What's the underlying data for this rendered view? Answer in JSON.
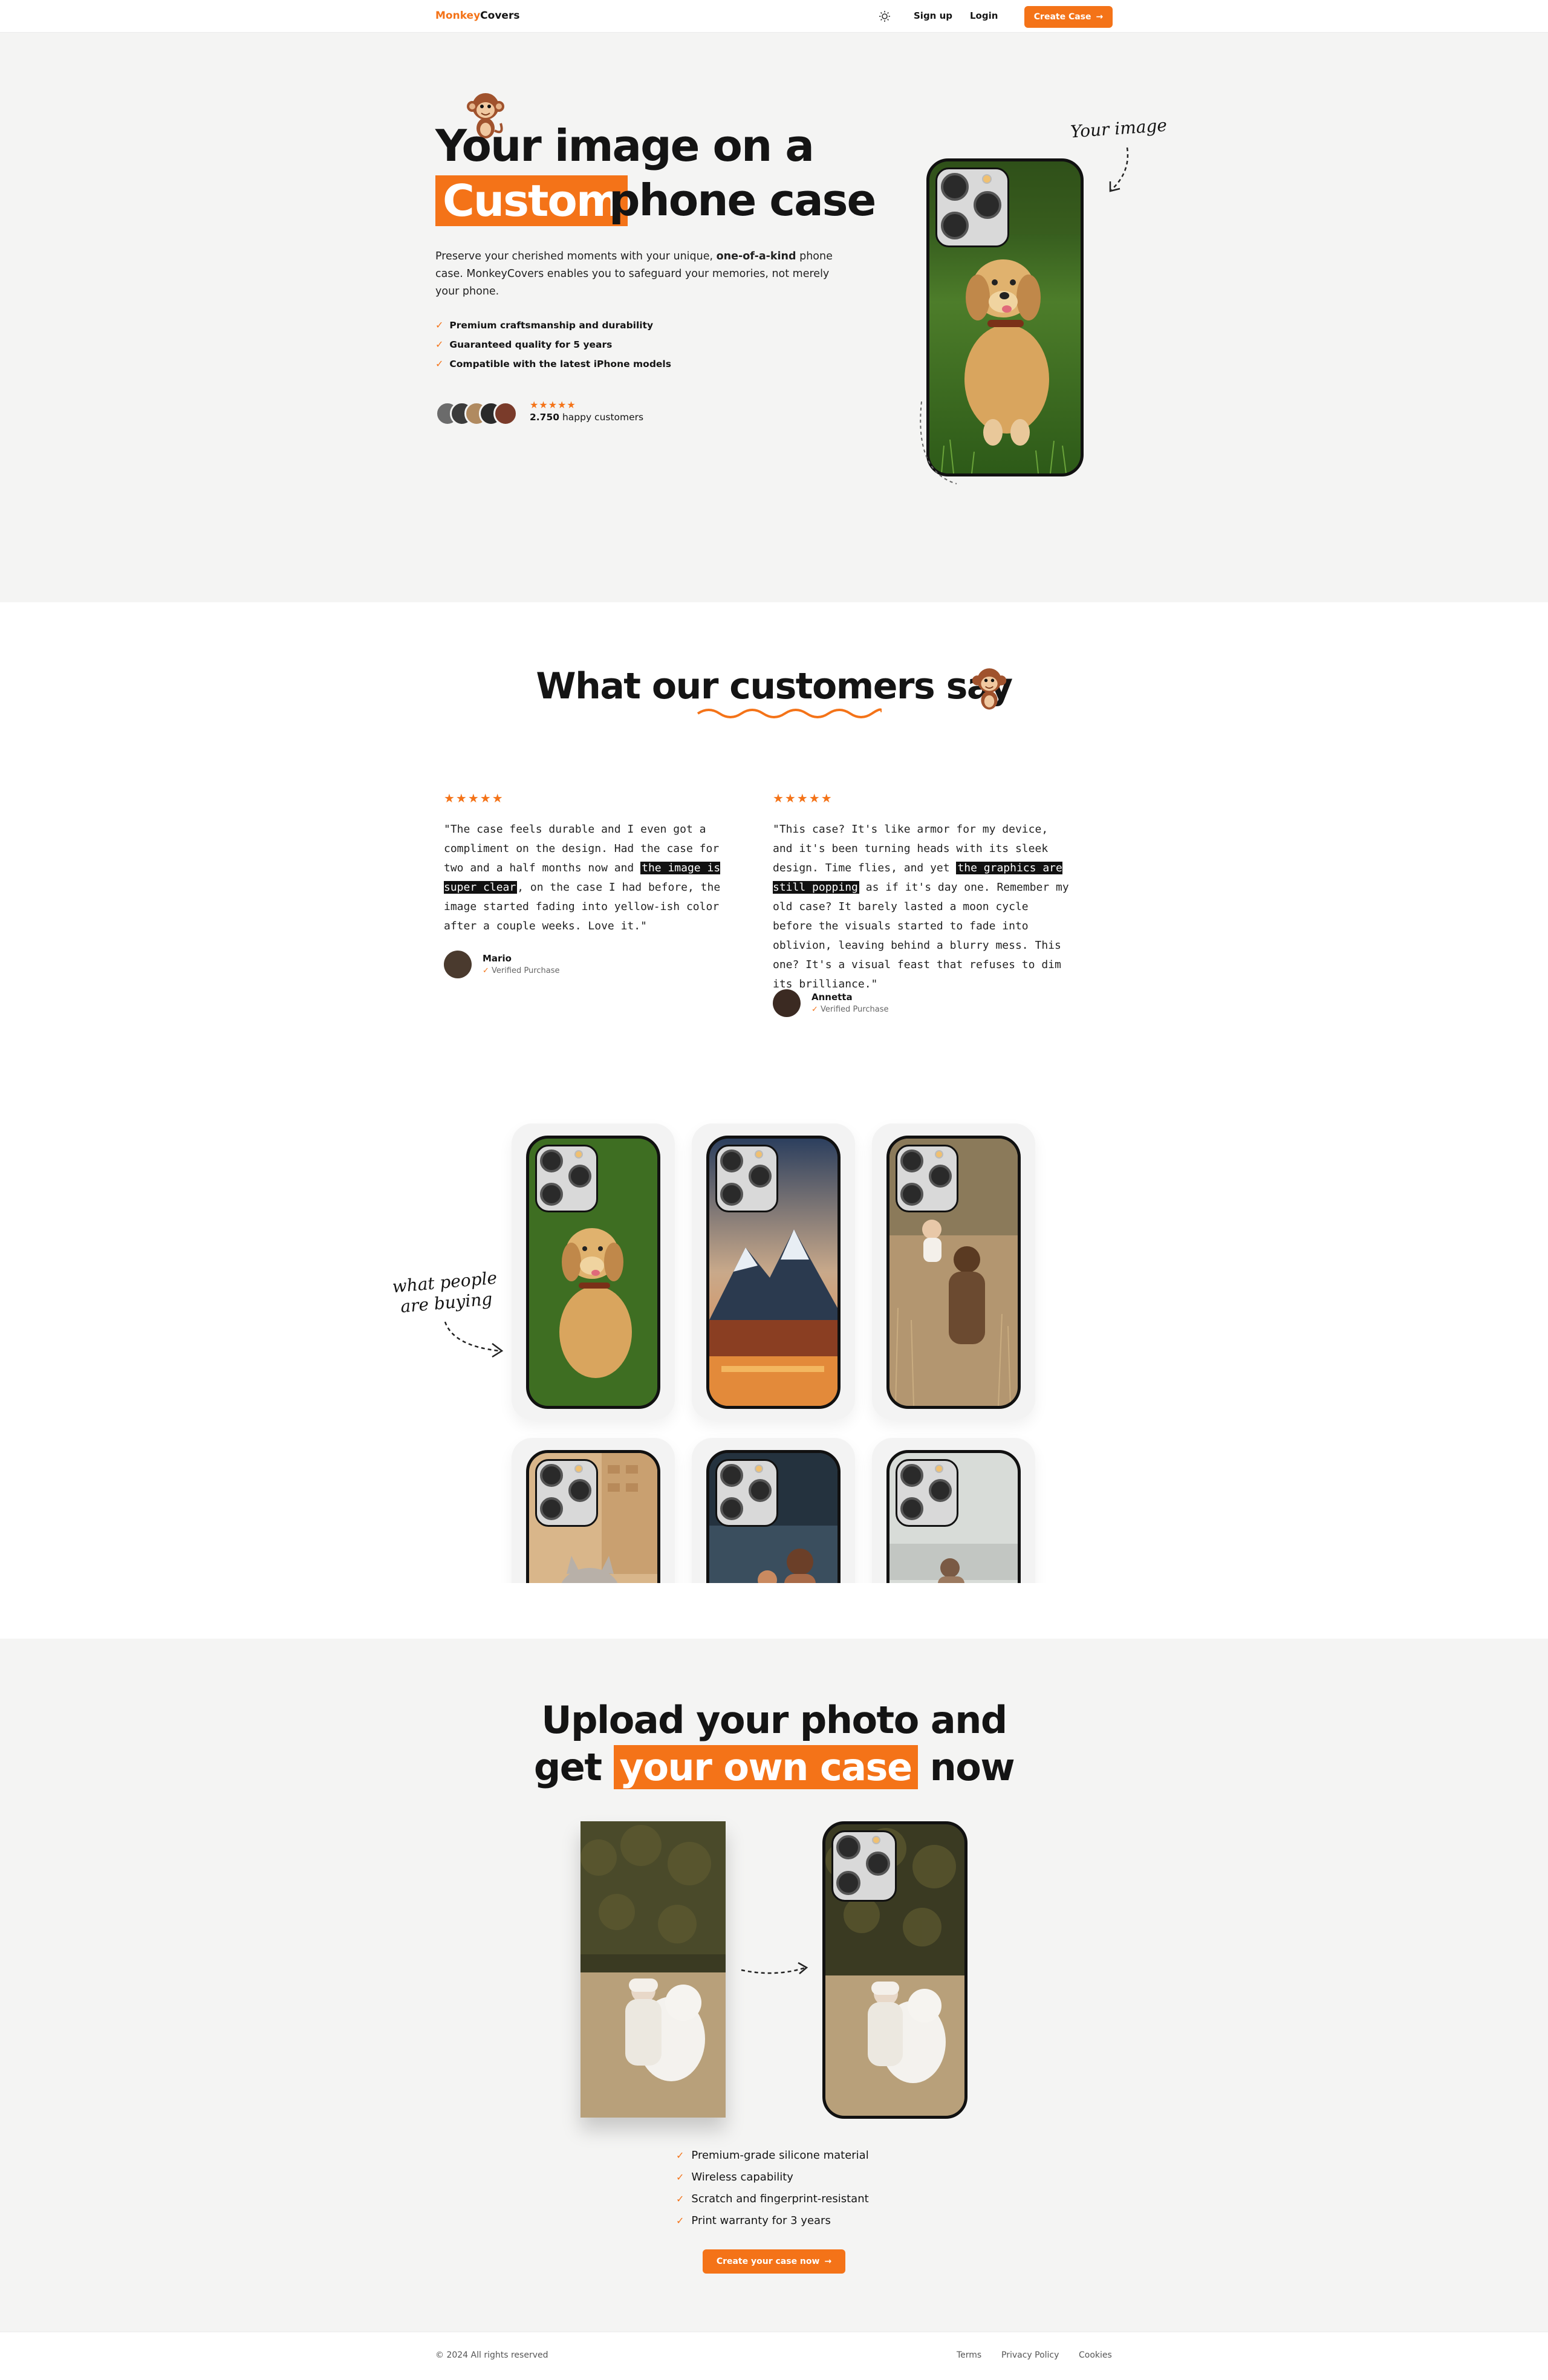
{
  "nav": {
    "logo_accent": "Monkey",
    "logo_rest": "Covers",
    "signup": "Sign up",
    "login": "Login",
    "create": "Create Case"
  },
  "hero": {
    "line1": "Your image on a",
    "custom": "Custom",
    "line2_rest": "phone case",
    "desc_pre": "Preserve your cherished moments with your unique, ",
    "desc_bold": "one-of-a-kind",
    "desc_post": " phone case. MonkeyCovers enables you to safeguard your memories, not merely your phone.",
    "features": [
      "Premium craftsmanship and durability",
      "Guaranteed quality for 5 years",
      "Compatible with the latest iPhone models"
    ],
    "stars": "★★★★★",
    "customers_count": "2.750",
    "customers_label": " happy customers",
    "annotation": "Your image"
  },
  "testimonials": {
    "title_pre": "What our ",
    "title_accent": "customers",
    "title_post": " say",
    "reviews": [
      {
        "stars": "★★★★★",
        "text_pre": "\"The case feels durable and I even got a compliment on the design. Had the case for two and a half months now and ",
        "highlight": "the image is super clear",
        "text_post": ", on the case I had before, the image started fading into yellow-ish color after a couple weeks. Love it.\"",
        "name": "Mario",
        "verified": "Verified Purchase"
      },
      {
        "stars": "★★★★★",
        "text_pre": "\"This case? It's like armor for my device, and it's been turning heads with its sleek design. Time flies, and yet ",
        "highlight": "the graphics are still popping",
        "text_post": " as if it's day one. Remember my old case? It barely lasted a moon cycle before the visuals started to fade into oblivion, leaving behind a blurry mess. This one? It's a visual feast that refuses to dim its brilliance.\"",
        "name": "Annetta",
        "verified": "Verified Purchase"
      }
    ]
  },
  "gallery": {
    "annotation_l1": "what people",
    "annotation_l2": "are buying"
  },
  "upload": {
    "line1": "Upload your photo and",
    "line2_pre": "get ",
    "line2_accent": "your own case",
    "line2_post": " now",
    "features": [
      "Premium-grade silicone material",
      "Wireless capability",
      "Scratch and fingerprint-resistant",
      "Print warranty for 3 years"
    ],
    "cta": "Create your case now"
  },
  "footer": {
    "copyright": "© 2024 All rights reserved",
    "links": [
      "Terms",
      "Privacy Policy",
      "Cookies"
    ]
  },
  "colors": {
    "accent": "#f47318",
    "hero_bg": "#f4f4f3"
  },
  "icons": [
    "sun-icon",
    "arrow-right-icon",
    "check-icon",
    "monkey-icon",
    "star-icon"
  ]
}
